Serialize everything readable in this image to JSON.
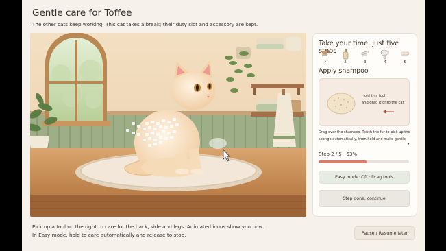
{
  "header": {
    "title": "Gentle care for Toffee",
    "subtitle": "The other cats keep working. This cat takes a break; their duty slot and accessory are kept."
  },
  "footer": {
    "instructions": "Pick up a tool on the right to care for the back, side and legs. Animated icons show you how. In Easy mode, hold to care automatically and release to stop.",
    "pause_label": "Pause / Resume later"
  },
  "panel": {
    "title": "Take your time, just five steps",
    "steps": [
      {
        "label": "✓",
        "icon": "brush-icon",
        "state": "done"
      },
      {
        "label": "2",
        "icon": "shampoo-icon",
        "state": "current"
      },
      {
        "label": "3",
        "icon": "comb-icon",
        "state": "pending"
      },
      {
        "label": "4",
        "icon": "dryer-icon",
        "state": "pending"
      },
      {
        "label": "5",
        "icon": "towel-icon",
        "state": "pending"
      }
    ],
    "current_step_title": "Apply shampoo",
    "tool_hint_line1": "Hold this tool",
    "tool_hint_line2": "and drag it onto the cat",
    "tool_icon": "sponge-icon",
    "instructions": "Drag over the shampoo. Touch the fur to pick up the sponge automatically, then hold and make gentle",
    "progress_text": "Step 2 / 5 · 53%",
    "progress": 0.53,
    "easy_mode_label": "Easy mode: Off · Drag tools",
    "done_label": "Step done, continue"
  },
  "colors": {
    "accent": "#d87d6c",
    "panel_bg": "#fffdf9",
    "page_bg": "#f6f1ea",
    "text": "#3b3128"
  }
}
